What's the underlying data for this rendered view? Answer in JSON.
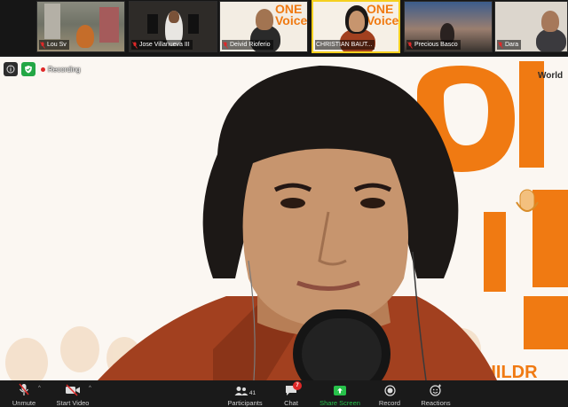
{
  "participants_strip": [
    {
      "name": "Lou Sv",
      "muted": true
    },
    {
      "name": "Jose Villanueva III",
      "muted": true
    },
    {
      "name": "Deivid Rioferio",
      "muted": true
    },
    {
      "name": "CHRISTIAN BAUT...",
      "muted": false,
      "active": true
    },
    {
      "name": "Precious Basco",
      "muted": true
    },
    {
      "name": "Dara",
      "muted": true
    }
  ],
  "status": {
    "recording_label": "Recording"
  },
  "toolbar": {
    "unmute_label": "Unmute",
    "start_video_label": "Start Video",
    "participants_label": "Participants",
    "participants_count": "41",
    "chat_label": "Chat",
    "chat_badge": "7",
    "share_label": "Share Screen",
    "record_label": "Record",
    "reactions_label": "Reactions"
  },
  "colors": {
    "accent_green": "#27c14a",
    "alert_red": "#e02828",
    "brand_orange": "#f07a12",
    "active_border": "#f5d01f"
  }
}
